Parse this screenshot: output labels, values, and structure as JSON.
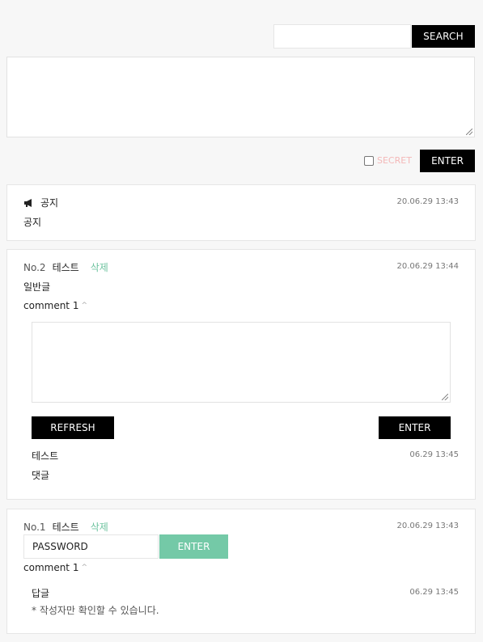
{
  "search": {
    "value": "",
    "button": "SEARCH"
  },
  "compose": {
    "secret_label": "SECRET",
    "enter": "ENTER"
  },
  "notice": {
    "icon": "megaphone-icon",
    "title": "공지",
    "date": "20.06.29 13:43",
    "body": "공지"
  },
  "post2": {
    "no": "No.2",
    "author": "테스트",
    "delete": "삭제",
    "date": "20.06.29 13:44",
    "body": "일반글",
    "comment_toggle": "comment 1",
    "refresh": "REFRESH",
    "enter": "ENTER",
    "comment": {
      "author": "테스트",
      "date": "06.29 13:45",
      "body": "댓글"
    }
  },
  "post1": {
    "no": "No.1",
    "author": "테스트",
    "delete": "삭제",
    "date": "20.06.29 13:43",
    "password_value": "PASSWORD",
    "enter": "ENTER",
    "comment_toggle": "comment 1",
    "comment": {
      "author": "답글",
      "date": "06.29 13:45",
      "body": "* 작성자만 확인할 수 있습니다."
    }
  }
}
